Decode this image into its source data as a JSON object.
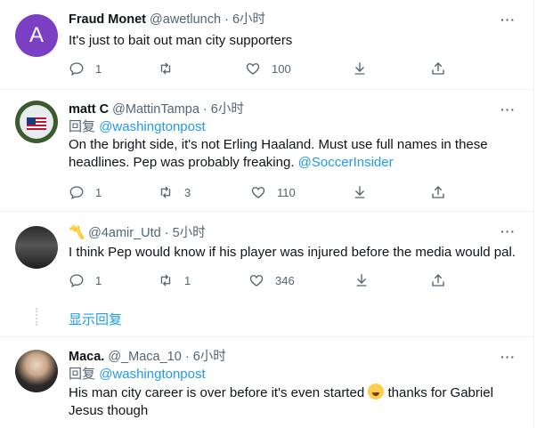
{
  "tweets": [
    {
      "avatar_letter": "A",
      "name": "Fraud Monet",
      "handle": "@awetlunch",
      "dot": "·",
      "time": "6小时",
      "text": "It's just to bait out man city supporters",
      "reply_count": "1",
      "retweet_count": "",
      "like_count": "100"
    },
    {
      "avatar_flag_text": "USA",
      "name": "matt C",
      "handle": "@MattinTampa",
      "dot": "·",
      "time": "6小时",
      "reply_prefix": "回复",
      "reply_to": "@washingtonpost",
      "text": "On the bright side, it's not Erling Haaland. Must use full names in these headlines. Pep was probably freaking.",
      "mention": "@SoccerInsider",
      "reply_count": "1",
      "retweet_count": "3",
      "like_count": "110"
    },
    {
      "name_emoji": "〽️",
      "handle": "@4amir_Utd",
      "dot": "·",
      "time": "5小时",
      "text": "I think Pep would know if his player was injured before the media would pal.",
      "reply_count": "1",
      "retweet_count": "1",
      "like_count": "346"
    },
    {
      "name": "Maca.",
      "handle": "@_Maca_10",
      "dot": "·",
      "time": "6小时",
      "reply_prefix": "回复",
      "reply_to": "@washingtonpost",
      "text_a": "His man city career is over before it's even started",
      "text_b": "thanks for Gabriel Jesus though"
    }
  ],
  "show_more_replies": "显示回复",
  "more_menu": "···",
  "colors": {
    "link": "#1d9bf0",
    "secondary_text": "#536471",
    "avatar_a": "#7b3fc4"
  },
  "icons": [
    "reply-icon",
    "retweet-icon",
    "like-icon",
    "download-icon",
    "share-icon",
    "more-icon"
  ]
}
